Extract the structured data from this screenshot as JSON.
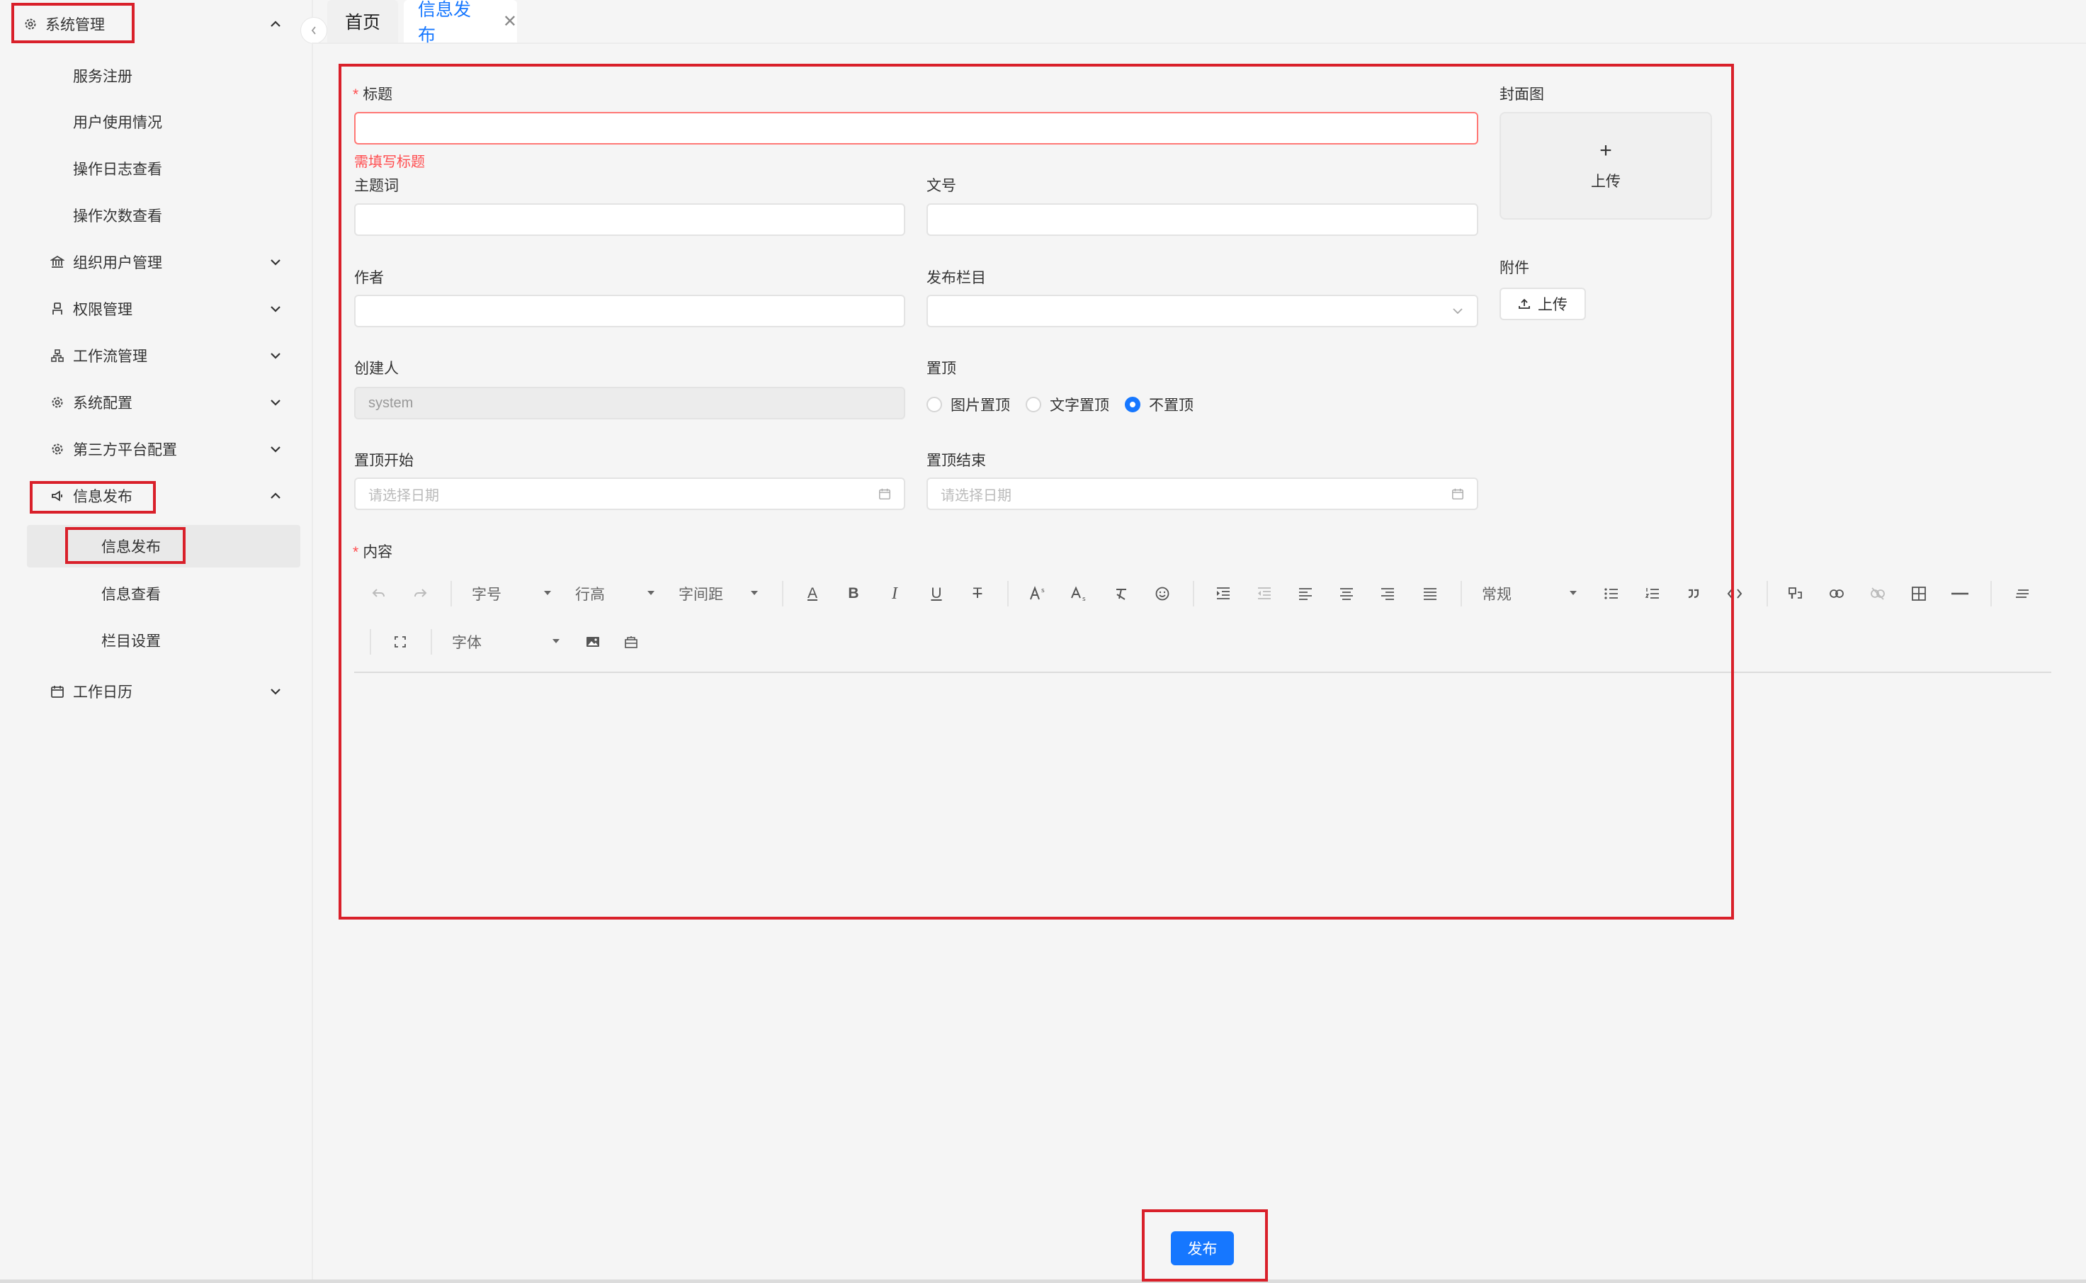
{
  "sidebar": {
    "system_mgmt": "系统管理",
    "sub_system": [
      "服务注册",
      "用户使用情况",
      "操作日志查看",
      "操作次数查看"
    ],
    "org_user": "组织用户管理",
    "permission": "权限管理",
    "workflow": "工作流管理",
    "sys_config": "系统配置",
    "third_party": "第三方平台配置",
    "info_publish": "信息发布",
    "sub_info": [
      "信息发布",
      "信息查看",
      "栏目设置"
    ],
    "work_calendar": "工作日历"
  },
  "tabs": {
    "home": "首页",
    "active": "信息发布",
    "close": "✕"
  },
  "form": {
    "title_label": "标题",
    "title_error": "需填写标题",
    "keyword_label": "主题词",
    "doc_no_label": "文号",
    "author_label": "作者",
    "column_label": "发布栏目",
    "creator_label": "创建人",
    "creator_value": "system",
    "pin_label": "置顶",
    "pin_options": [
      "图片置顶",
      "文字置顶",
      "不置顶"
    ],
    "pin_selected": "不置顶",
    "pin_start_label": "置顶开始",
    "pin_start_placeholder": "请选择日期",
    "pin_end_label": "置顶结束",
    "pin_end_placeholder": "请选择日期",
    "content_label": "内容",
    "required_mark": "*",
    "cover_label": "封面图",
    "cover_plus": "+",
    "cover_upload": "上传",
    "attach_label": "附件",
    "attach_upload": "上传"
  },
  "toolbar": {
    "font_size": "字号",
    "line_height": "行高",
    "letter_spacing": "字间距",
    "paragraph": "常规",
    "font_family": "字体",
    "font_color_glyph": "A",
    "bold_glyph": "B",
    "italic_glyph": "I",
    "underline_glyph": "U",
    "strike_glyph": "T"
  },
  "actions": {
    "publish": "发布"
  },
  "colors": {
    "primary": "#1677ff",
    "error": "#ff4d4f",
    "highlight": "#d9202a"
  }
}
